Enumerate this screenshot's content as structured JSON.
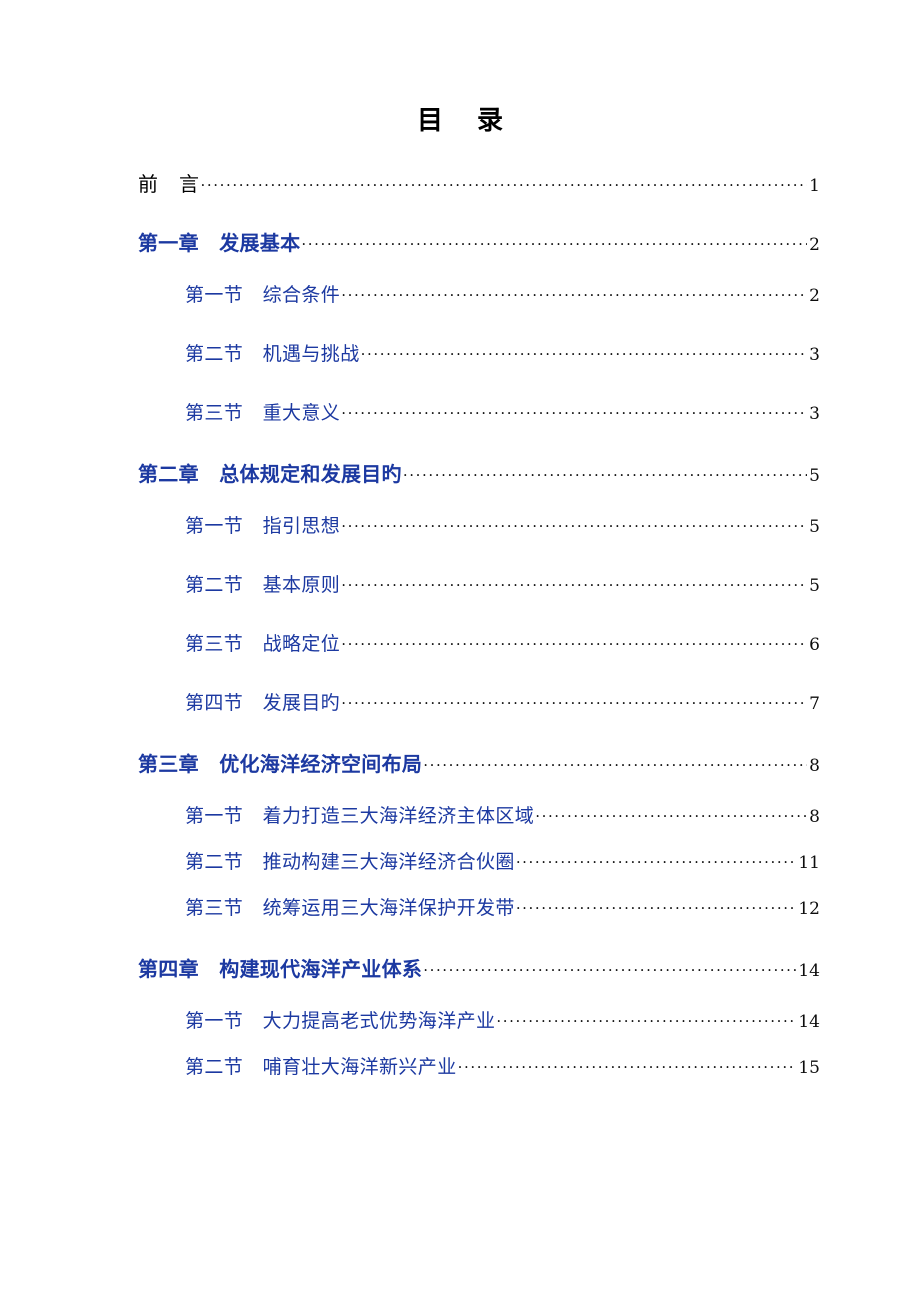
{
  "document": {
    "title_chars": [
      "目",
      "录"
    ],
    "colors": {
      "heading_black": "#000000",
      "entry_blue": "#1C39A1",
      "leader_black": "#121212"
    }
  },
  "toc": {
    "front_matter": {
      "label": "前　言",
      "page": "1"
    },
    "chapters": [
      {
        "label": "第一章　发展基本",
        "page": "2",
        "spacing": "loose",
        "sections": [
          {
            "label": "第一节　综合条件",
            "page": "2"
          },
          {
            "label": "第二节　机遇与挑战",
            "page": "3"
          },
          {
            "label": "第三节　重大意义",
            "page": "3"
          }
        ]
      },
      {
        "label": "第二章　总体规定和发展目旳",
        "page": "5",
        "spacing": "loose",
        "sections": [
          {
            "label": "第一节　指引思想",
            "page": "5"
          },
          {
            "label": "第二节　基本原则",
            "page": "5"
          },
          {
            "label": "第三节　战略定位",
            "page": "6"
          },
          {
            "label": "第四节　发展目旳",
            "page": "7"
          }
        ]
      },
      {
        "label": "第三章　优化海洋经济空间布局",
        "page": "8",
        "spacing": "tight",
        "sections": [
          {
            "label": "第一节　着力打造三大海洋经济主体区域",
            "page": "8"
          },
          {
            "label": "第二节　推动构建三大海洋经济合伙圈",
            "page": "11"
          },
          {
            "label": "第三节　统筹运用三大海洋保护开发带",
            "page": "12"
          }
        ]
      },
      {
        "label": "第四章　构建现代海洋产业体系",
        "page": "14",
        "spacing": "tight",
        "sections": [
          {
            "label": "第一节　大力提高老式优势海洋产业",
            "page": "14"
          },
          {
            "label": "第二节　哺育壮大海洋新兴产业",
            "page": "15"
          }
        ]
      }
    ]
  }
}
